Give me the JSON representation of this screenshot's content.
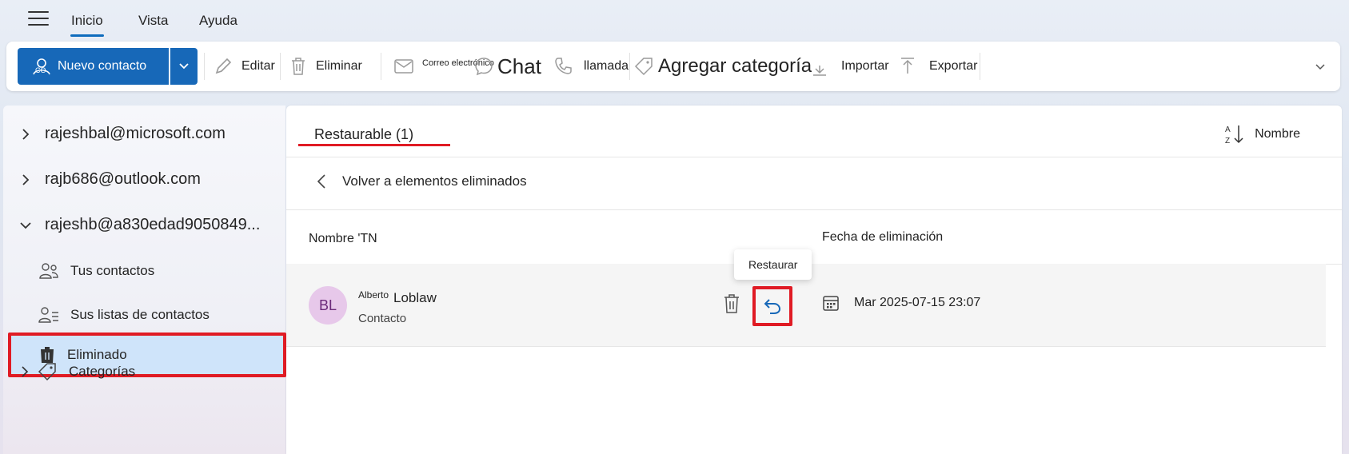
{
  "menu": {
    "tabs": [
      {
        "label": "Inicio",
        "active": true
      },
      {
        "label": "Vista",
        "active": false
      },
      {
        "label": "Ayuda",
        "active": false
      }
    ]
  },
  "ribbon": {
    "new_contact": "Nuevo contacto",
    "edit": "Editar",
    "delete": "Eliminar",
    "email": "Correo electrónico",
    "chat": "Chat",
    "call": "llamada",
    "add_category": "Agregar categoría",
    "import": "Importar",
    "export": "Exportar"
  },
  "sidebar": {
    "accounts": [
      {
        "label": "rajeshbal@microsoft.com",
        "expanded": false
      },
      {
        "label": "rajb686@outlook.com",
        "expanded": false
      },
      {
        "label": "rajeshb@a830edad9050849...",
        "expanded": true
      }
    ],
    "items": [
      {
        "label": "Tus contactos",
        "icon": "people-icon"
      },
      {
        "label": "Sus listas de contactos",
        "icon": "contact-list-icon"
      },
      {
        "label": "Eliminado",
        "icon": "trash-icon",
        "selected": true
      },
      {
        "label": "Categorías",
        "icon": "tag-icon"
      }
    ]
  },
  "main": {
    "tab_label": "Restaurable (1)",
    "sort_label": "Nombre",
    "back_label": "Volver a elementos eliminados",
    "columns": {
      "name": "Nombre 'TN",
      "date": "Fecha de eliminación"
    },
    "rows": [
      {
        "initials": "BL",
        "prefix": "Alberto",
        "name": "Loblaw",
        "type": "Contacto",
        "deleted_date": "Mar 2025-07-15 23:07"
      }
    ],
    "tooltip": "Restaurar"
  },
  "colors": {
    "accent": "#1768b8",
    "highlight_red": "#e01b24",
    "selected_bg": "#cfe4fa",
    "avatar_bg": "#e7c8ea"
  }
}
